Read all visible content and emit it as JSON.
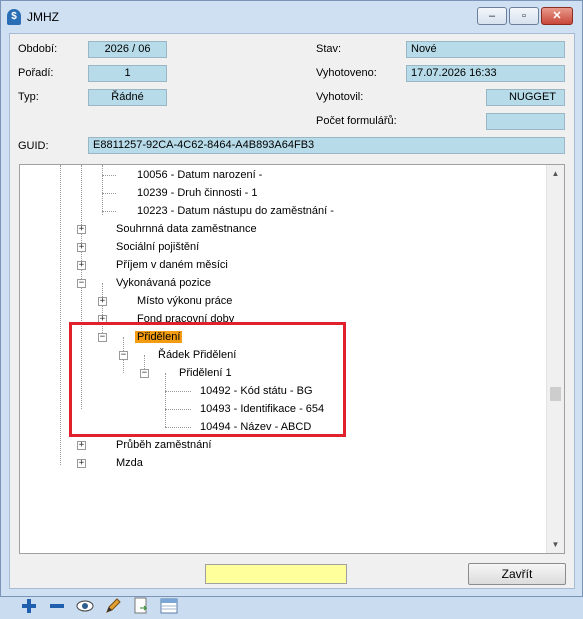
{
  "window": {
    "title": "JMHZ",
    "min_glyph": "–",
    "max_glyph": "▫",
    "close_glyph": "✕"
  },
  "form": {
    "obdobi_label": "Období:",
    "obdobi_value": "2026 / 06",
    "poradi_label": "Pořadí:",
    "poradi_value": "1",
    "typ_label": "Typ:",
    "typ_value": "Řádné",
    "stav_label": "Stav:",
    "stav_value": "Nové",
    "vyhotoveno_label": "Vyhotoveno:",
    "vyhotoveno_value": "17.07.2026 16:33",
    "vyhotovil_label": "Vyhotovil:",
    "vyhotovil_value": "NUGGET",
    "pocet_label": "Počet formulářů:",
    "pocet_value": "",
    "guid_label": "GUID:",
    "guid_value": "E8811257-92CA-4C62-8464-A4B893A64FB3"
  },
  "tree": {
    "items": [
      "10056 - Datum narození -",
      "10239 - Druh činnosti - 1",
      "10223 - Datum nástupu do zaměstnání -",
      "Souhrnná data zaměstnance",
      "Sociální pojištění",
      "Příjem v daném měsíci",
      "Vykonávaná pozice",
      "Místo výkonu práce",
      "Fond pracovní doby",
      "Přidělení",
      "Řádek Přidělení",
      "Přidělení 1",
      "10492 - Kód státu - BG",
      "10493 - Identifikace - 654",
      "10494 - Název - ABCD",
      "Průběh zaměstnání",
      "Mzda"
    ],
    "selected": "Přidělení"
  },
  "toolbar": {
    "add_glyph": "+",
    "remove_glyph": "−",
    "search_value": "",
    "close_label": "Zavřít"
  },
  "colors": {
    "field_bg": "#b7dbe9",
    "selection": "#f39c12",
    "highlight_box": "#e0202a",
    "search_bg": "#ffff9c"
  }
}
